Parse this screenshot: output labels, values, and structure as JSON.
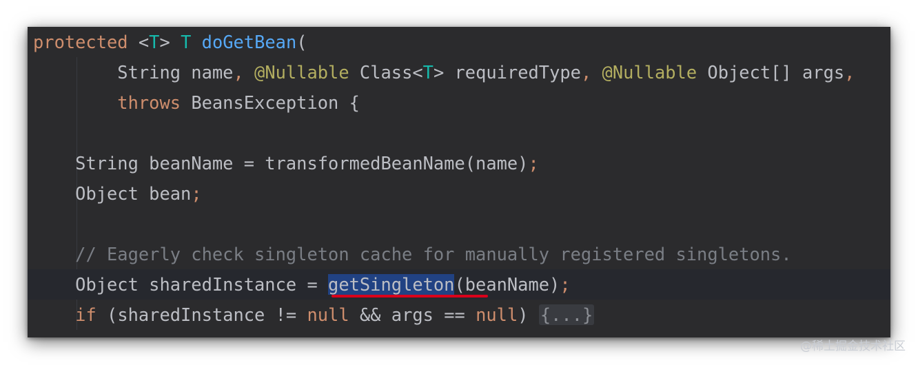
{
  "code": {
    "l1": {
      "kw": "protected",
      "lt": "<",
      "t1": "T",
      "gt": ">",
      "t2": "T",
      "fn": "doGetBean",
      "rest": "("
    },
    "l2": {
      "a": "String name",
      "comma1": ",",
      "ann1": "@Nullable",
      "b": "Class<",
      "t": "T",
      "c": "> requiredType",
      "comma2": ",",
      "ann2": "@Nullable",
      "d": "Object[] args",
      "comma3": ","
    },
    "l3": {
      "kw": "throws",
      "rest": "BeansException {"
    },
    "l5": {
      "text": "String beanName = transformedBeanName(name)",
      "semi": ";"
    },
    "l6": {
      "text": "Object bean",
      "semi": ";"
    },
    "l8": {
      "comment": "// Eagerly check singleton cache for manually registered singletons."
    },
    "l9": {
      "a": "Object sharedInstance = ",
      "method": "getSingleton",
      "b": "(beanName)",
      "semi": ";"
    },
    "l10": {
      "kw": "if",
      "a": "(sharedInstance != ",
      "null1": "null",
      "b": "&& args == ",
      "null2": "null",
      "c": ")",
      "fold": "{...}"
    }
  },
  "watermark": "@稀土掘金技术社区",
  "colors": {
    "background": "#2b2b2d",
    "keyword": "#cf8e6d",
    "type_param": "#16baac",
    "function": "#56a8f5",
    "annotation": "#b3ae60",
    "comment": "#7a7e85",
    "selection": "#214283",
    "underline": "#d9001b"
  }
}
